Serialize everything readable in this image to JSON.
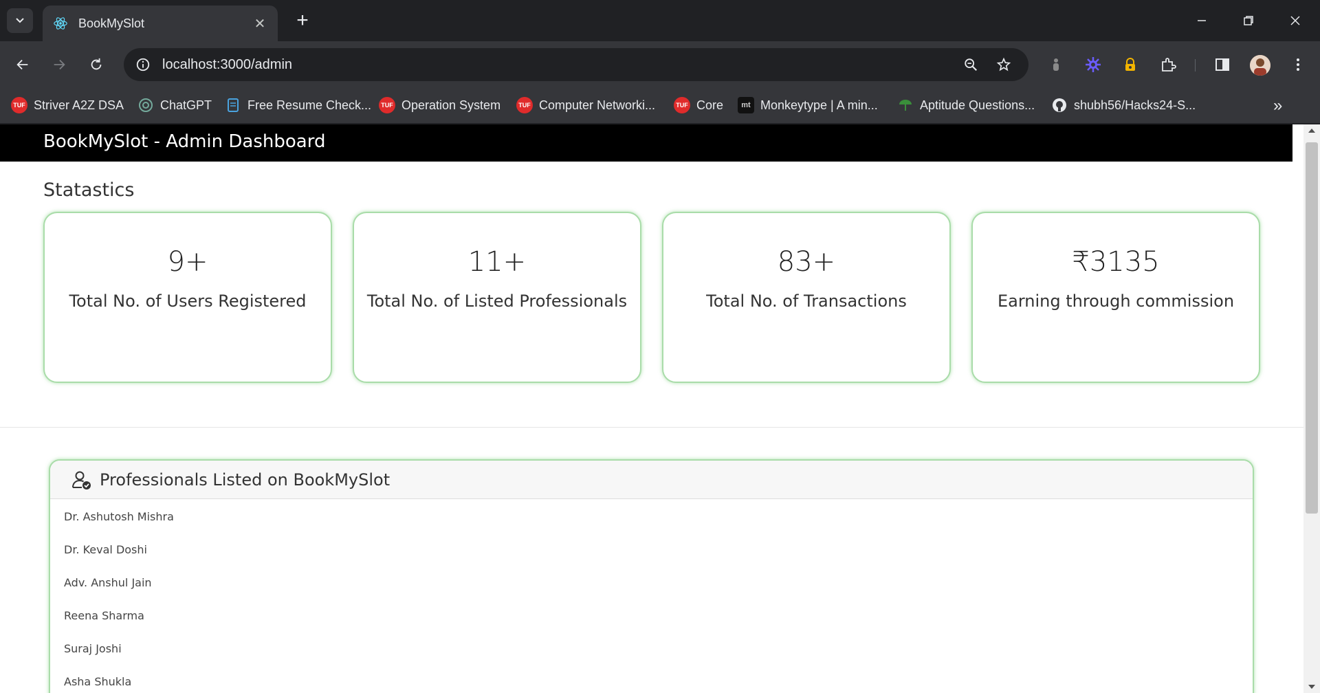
{
  "browser": {
    "tab_title": "BookMySlot",
    "url": "localhost:3000/admin",
    "bookmarks": [
      {
        "label": "Striver A2Z DSA",
        "icon": "tuf-icon",
        "color": "#e02b2b"
      },
      {
        "label": "ChatGPT",
        "icon": "chatgpt-icon",
        "color": "#74aa9c"
      },
      {
        "label": "Free Resume Check...",
        "icon": "resume-icon",
        "color": "#4aa3df"
      },
      {
        "label": "Operation System",
        "icon": "tuf-icon",
        "color": "#e02b2b"
      },
      {
        "label": "Computer Networki...",
        "icon": "tuf-icon",
        "color": "#e02b2b"
      },
      {
        "label": "Core",
        "icon": "tuf-icon",
        "color": "#e02b2b"
      },
      {
        "label": "Monkeytype | A min...",
        "icon": "monkeytype-icon",
        "color": "#111111"
      },
      {
        "label": "Aptitude Questions...",
        "icon": "indiabix-icon",
        "color": "#3a8f3a"
      },
      {
        "label": "shubh56/Hacks24-S...",
        "icon": "github-icon",
        "color": "#e8eaed"
      }
    ],
    "tuf_text": "TUF",
    "mt_text": "mt"
  },
  "app": {
    "title": "BookMySlot - Admin Dashboard",
    "section_title": "Statastics",
    "stats": [
      {
        "value": "9+",
        "label": "Total No. of Users Registered"
      },
      {
        "value": "11+",
        "label": "Total No. of Listed Professionals"
      },
      {
        "value": "83+",
        "label": "Total No. of Transactions"
      },
      {
        "value": "₹3135",
        "label": "Earning through commission"
      }
    ],
    "professionals": {
      "title": "Professionals Listed on BookMySlot",
      "items": [
        "Dr. Ashutosh Mishra",
        "Dr. Keval Doshi",
        "Adv. Anshul Jain",
        "Reena Sharma",
        "Suraj Joshi",
        "Asha Shukla"
      ]
    },
    "colors": {
      "accent_border": "#a9dca9",
      "appbar_bg": "#000000"
    }
  }
}
